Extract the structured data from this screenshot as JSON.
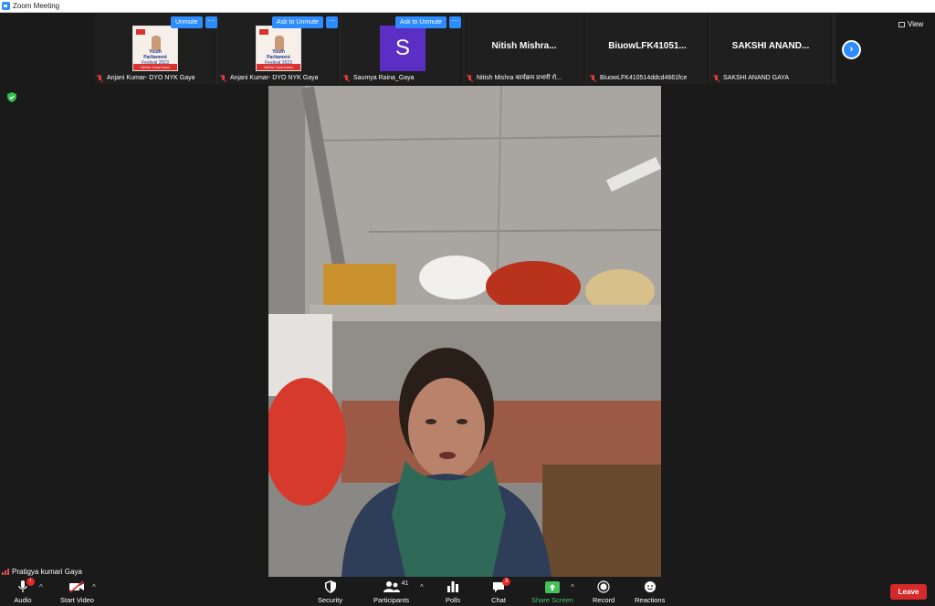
{
  "window": {
    "title": "Zoom Meeting"
  },
  "strip": {
    "tiles": [
      {
        "name": "Anjani Kumar- DYO NYK Gaya",
        "action": "Unmute",
        "kind": "poster"
      },
      {
        "name": "Anjani Kumar- DYO NYK Gaya",
        "action": "Ask to Unmute",
        "kind": "poster"
      },
      {
        "name": "Saumya Raina_Gaya",
        "action": "Ask to Unmute",
        "kind": "avatar",
        "initial": "S"
      },
      {
        "name": "Nitish Mishra कार्यक्रम प्रभारी रो...",
        "display": "Nitish  Mishra...",
        "kind": "name"
      },
      {
        "name": "BiuowLFK410514ddcd4661fce",
        "display": "BiuowLFK41051...",
        "kind": "name"
      },
      {
        "name": "SAKSHI ANAND GAYA",
        "display": "SAKSHI  ANAND...",
        "kind": "name"
      }
    ],
    "more_label": "···",
    "poster": {
      "line1": "Youth",
      "line2": "Parliament",
      "line3": "Festival 2023",
      "band": "Nehru Yuva Kend"
    },
    "next_icon": "chevron-right-icon"
  },
  "view": {
    "label": "View",
    "icon": "grid-icon"
  },
  "speaker": {
    "name": "Pratigya kumari Gaya"
  },
  "toolbar": {
    "audio": {
      "label": "Audio",
      "badge": "!"
    },
    "video": {
      "label": "Start Video"
    },
    "security": {
      "label": "Security"
    },
    "participants": {
      "label": "Participants",
      "count": "41"
    },
    "polls": {
      "label": "Polls"
    },
    "chat": {
      "label": "Chat",
      "badge": "3"
    },
    "share": {
      "label": "Share Screen"
    },
    "record": {
      "label": "Record"
    },
    "reactions": {
      "label": "Reactions"
    },
    "leave": {
      "label": "Leave"
    }
  },
  "colors": {
    "accent": "#2d8cff",
    "leave": "#d62a2a",
    "share": "#43c25a",
    "muted": "#e03b3b",
    "avatar": "#5b2fc4"
  }
}
